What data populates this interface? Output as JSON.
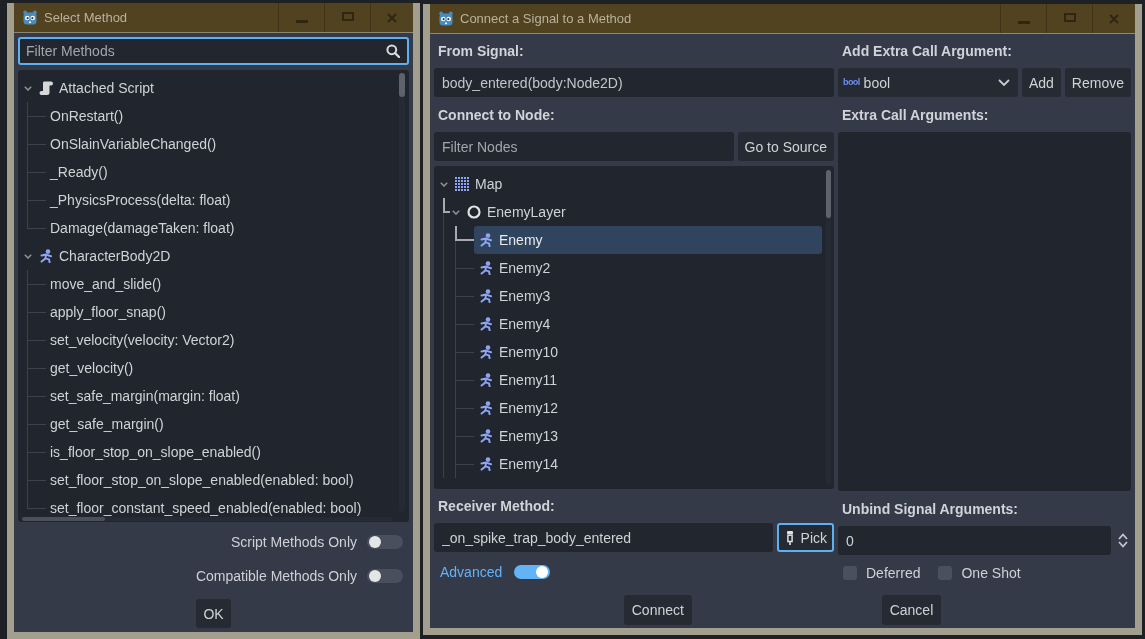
{
  "select_method_window": {
    "title": "Select Method",
    "filter": {
      "placeholder": "Filter Methods",
      "focused": true
    },
    "method_tree": [
      {
        "label": "Attached Script",
        "kind": "script",
        "expanded": true,
        "selected": false,
        "children": [
          {
            "label": "OnRestart()",
            "selected": false
          },
          {
            "label": "OnSlainVariableChanged()",
            "selected": false
          },
          {
            "label": "_Ready()",
            "selected": false
          },
          {
            "label": "_PhysicsProcess(delta: float)",
            "selected": false
          },
          {
            "label": "Damage(damageTaken: float)",
            "selected": false
          }
        ]
      },
      {
        "label": "CharacterBody2D",
        "kind": "character",
        "expanded": true,
        "selected": false,
        "children": [
          {
            "label": "move_and_slide()",
            "selected": false
          },
          {
            "label": "apply_floor_snap()",
            "selected": false
          },
          {
            "label": "set_velocity(velocity: Vector2)",
            "selected": false
          },
          {
            "label": "get_velocity()",
            "selected": false
          },
          {
            "label": "set_safe_margin(margin: float)",
            "selected": false
          },
          {
            "label": "get_safe_margin()",
            "selected": false
          },
          {
            "label": "is_floor_stop_on_slope_enabled()",
            "selected": false
          },
          {
            "label": "set_floor_stop_on_slope_enabled(enabled: bool)",
            "selected": false
          },
          {
            "label": "set_floor_constant_speed_enabled(enabled: bool)",
            "selected": false
          }
        ]
      }
    ],
    "toggles": [
      {
        "label": "Script Methods Only",
        "on": false
      },
      {
        "label": "Compatible Methods Only",
        "on": false
      }
    ],
    "buttons": [
      "OK"
    ]
  },
  "connect_window": {
    "title": "Connect a Signal to a Method",
    "from_signal": {
      "label": "From Signal:",
      "value": "body_entered(body:Node2D)"
    },
    "connect_to_node": {
      "label": "Connect to Node:",
      "filter": {
        "placeholder": "Filter Nodes"
      },
      "button": "Go to Source",
      "tree": [
        {
          "label": "Map",
          "kind": "tilemap",
          "expanded": true,
          "selected": false,
          "children": [
            {
              "label": "EnemyLayer",
              "kind": "node",
              "expanded": true,
              "selected": false,
              "children": [
                {
                  "label": "Enemy",
                  "kind": "character",
                  "selected": true
                },
                {
                  "label": "Enemy2",
                  "kind": "character",
                  "selected": false
                },
                {
                  "label": "Enemy3",
                  "kind": "character",
                  "selected": false
                },
                {
                  "label": "Enemy4",
                  "kind": "character",
                  "selected": false
                },
                {
                  "label": "Enemy10",
                  "kind": "character",
                  "selected": false
                },
                {
                  "label": "Enemy11",
                  "kind": "character",
                  "selected": false
                },
                {
                  "label": "Enemy12",
                  "kind": "character",
                  "selected": false
                },
                {
                  "label": "Enemy13",
                  "kind": "character",
                  "selected": false
                },
                {
                  "label": "Enemy14",
                  "kind": "character",
                  "selected": false
                }
              ]
            }
          ]
        }
      ]
    },
    "receiver_method": {
      "label": "Receiver Method:",
      "value": "_on_spike_trap_body_entered",
      "button": {
        "label": "Pick",
        "focused": true
      }
    },
    "advanced": {
      "label": "Advanced",
      "on": true
    },
    "add_extra_call_argument": {
      "label": "Add Extra Call Argument:",
      "type_icon": "bool",
      "type": "bool",
      "buttons": [
        "Add",
        "Remove"
      ]
    },
    "extra_call_arguments": {
      "label": "Extra Call Arguments:"
    },
    "unbind_signal_arguments": {
      "label": "Unbind Signal Arguments:",
      "value": "0"
    },
    "options": [
      {
        "label": "Deferred",
        "checked": false
      },
      {
        "label": "One Shot",
        "checked": false
      }
    ],
    "buttons": [
      "Connect",
      "Cancel"
    ]
  }
}
